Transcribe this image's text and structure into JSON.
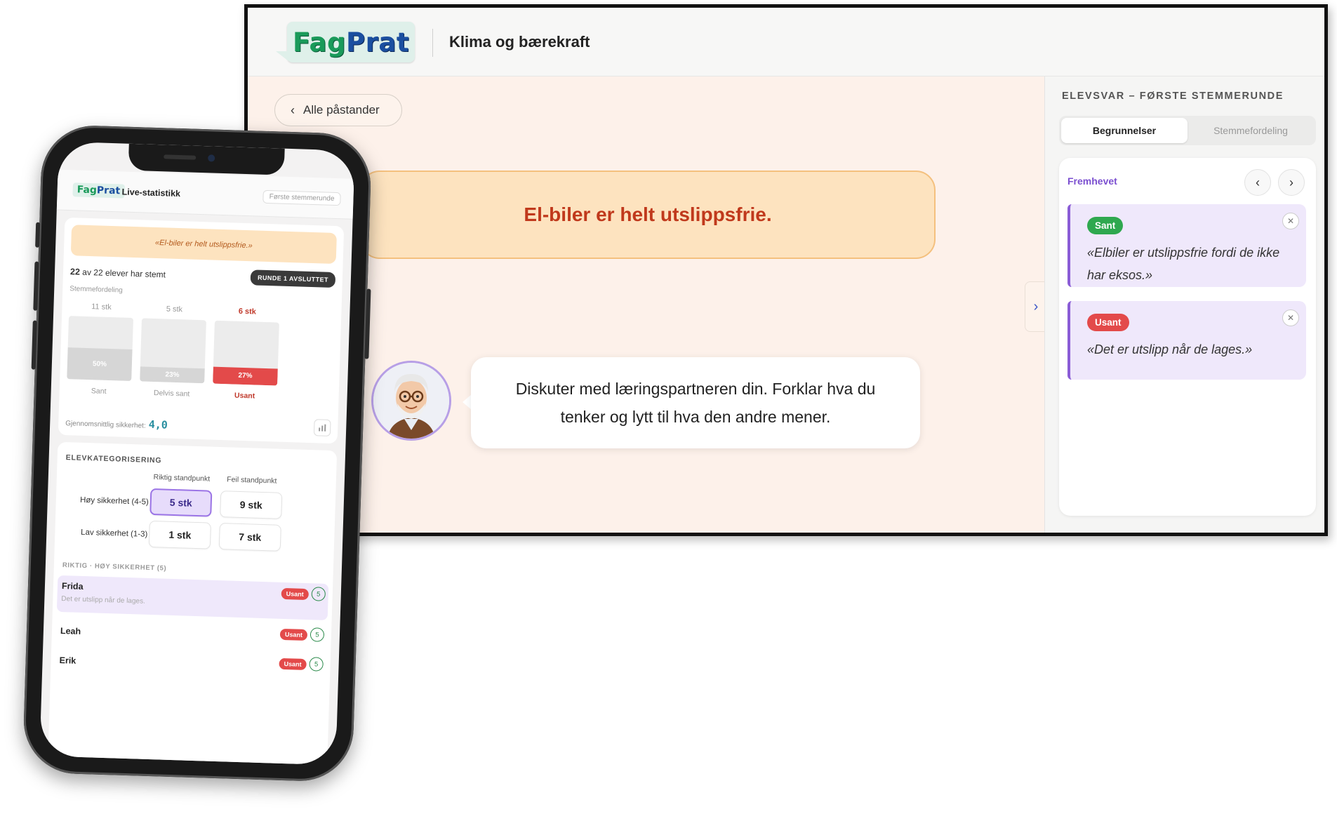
{
  "desktop": {
    "logo": {
      "part1": "Fag",
      "part2": "Prat"
    },
    "title": "Klima og bærekraft",
    "back_label": "Alle påstander",
    "claim": "El-biler er helt utslippsfrie.",
    "prompt": "Diskuter med læringspartneren din. Forklar hva du tenker og lytt til hva den andre mener.",
    "sidebar": {
      "heading": "ELEVSVAR – FØRSTE STEMMERUNDE",
      "tabs": [
        "Begrunnelser",
        "Stemmefordeling"
      ],
      "section": "Fremhevet",
      "reasons": [
        {
          "verdict": "Sant",
          "text": "«Elbiler er utslippsfrie fordi de ikke har eksos.»"
        },
        {
          "verdict": "Usant",
          "text": "«Det er utslipp når de lages.»"
        }
      ]
    }
  },
  "phone": {
    "logo": {
      "part1": "Fag",
      "part2": "Prat"
    },
    "title": "Live-statistikk",
    "round": "Første stemmerunde",
    "claim": "«El-biler er helt utslippsfrie.»",
    "voted_bold": "22",
    "voted_rest": "av 22 elever har stemt",
    "status": "RUNDE 1 AVSLUTTET",
    "dist_label": "Stemmefordeling",
    "bars": [
      {
        "count": "11 stk",
        "pct": "50%",
        "label": "Sant",
        "value": 50
      },
      {
        "count": "5 stk",
        "pct": "23%",
        "label": "Delvis sant",
        "value": 23
      },
      {
        "count": "6 stk",
        "pct": "27%",
        "label": "Usant",
        "value": 27
      }
    ],
    "avg_label": "Gjennomsnittlig sikkerhet:",
    "avg_value": "4,0",
    "cat_heading": "ELEVKATEGORISERING",
    "cols": [
      "Riktig standpunkt",
      "Feil standpunkt"
    ],
    "rows": [
      {
        "label": "Høy sikkerhet (4-5)",
        "cells": [
          "5 stk",
          "9 stk"
        ]
      },
      {
        "label": "Lav sikkerhet (1-3)",
        "cells": [
          "1 stk",
          "7 stk"
        ]
      }
    ],
    "list_heading": "RIKTIG · HØY SIKKERHET (5)",
    "students": [
      {
        "name": "Frida",
        "text": "Det er utslipp når de lages.",
        "tag": "Usant",
        "score": "5"
      },
      {
        "name": "Leah",
        "text": "",
        "tag": "Usant",
        "score": "5"
      },
      {
        "name": "Erik",
        "text": "",
        "tag": "Usant",
        "score": "5"
      }
    ]
  }
}
